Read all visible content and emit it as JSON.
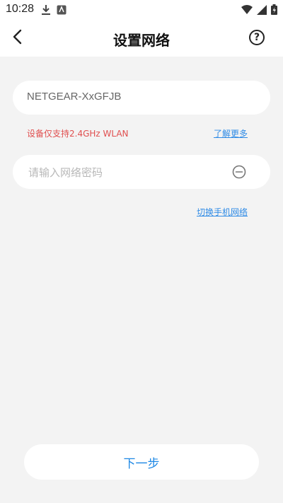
{
  "status_bar": {
    "time": "10:28",
    "left_icons": [
      "download-icon",
      "app-notification-icon"
    ],
    "right_icons": [
      "wifi-icon",
      "signal-icon",
      "battery-icon"
    ]
  },
  "header": {
    "title": "设置网络",
    "back_icon": "back-chevron-icon",
    "help_icon": "help-icon",
    "help_glyph": "?"
  },
  "network": {
    "ssid": "NETGEAR-XxGFJB",
    "warning": "设备仅支持2.4GHz WLAN",
    "learn_more": "了解更多"
  },
  "password": {
    "placeholder": "请输入网络密码",
    "value": "",
    "visibility_icon": "eye-hidden-icon"
  },
  "switch_network": "切换手机网络",
  "next_button": "下一步",
  "colors": {
    "background": "#f3f3f3",
    "card": "#ffffff",
    "warning": "#e04f4f",
    "link": "#2f8be6",
    "primary": "#1e88e5"
  }
}
